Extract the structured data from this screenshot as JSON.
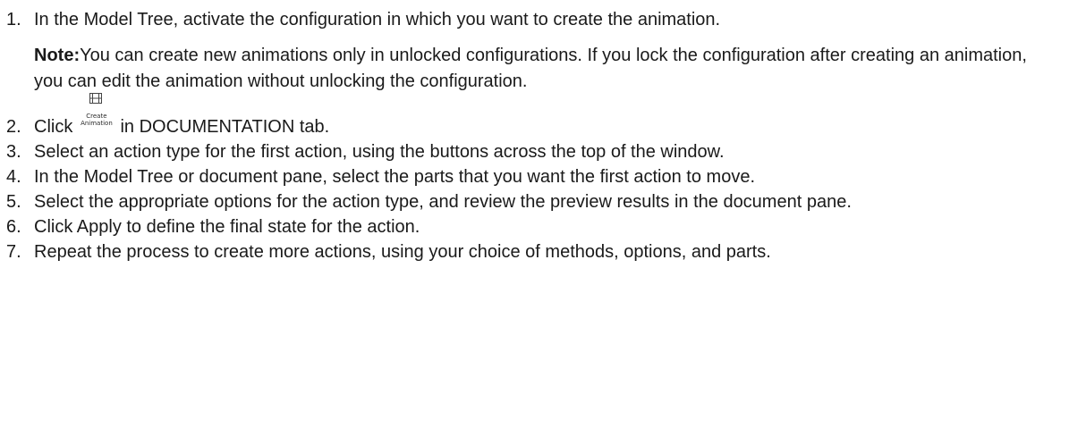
{
  "steps": [
    {
      "num": "1.",
      "text": "In the Model Tree, activate the configuration in which you want to create the animation."
    },
    {
      "num": "2.",
      "text_before": "Click",
      "text_after": "in DOCUMENTATION tab."
    },
    {
      "num": "3.",
      "text": "Select an action type for the first action, using the buttons across the top of the window."
    },
    {
      "num": "4.",
      "text": "In the Model Tree or document pane, select the parts that you want the first action to move."
    },
    {
      "num": "5.",
      "text": "Select the appropriate options for the action type, and review the preview results in the document pane."
    },
    {
      "num": "6.",
      "text": "Click Apply to define the final state for the action."
    },
    {
      "num": "7.",
      "text": "Repeat the process to create more actions, using your choice of methods, options, and parts."
    }
  ],
  "note": {
    "label": "Note:",
    "text": "You can create new animations only in unlocked configurations. If you lock the configuration after creating an animation, you can edit the animation without unlocking the configuration."
  },
  "create_animation_button": {
    "icon": "film-icon",
    "label_line1": "Create",
    "label_line2": "Animation"
  }
}
